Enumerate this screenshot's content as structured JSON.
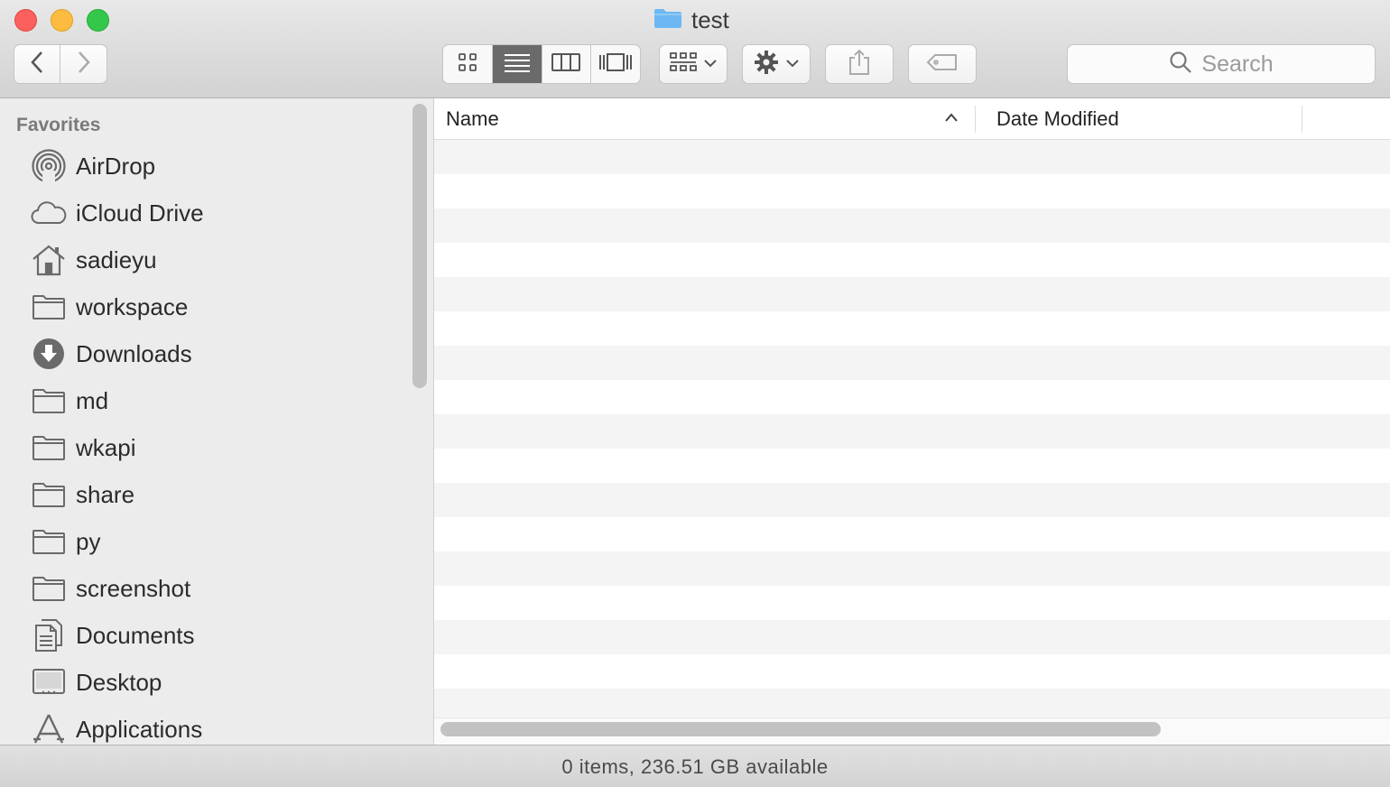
{
  "window": {
    "title": "test"
  },
  "toolbar": {
    "back": "back",
    "forward": "forward",
    "views": [
      "icon-view",
      "list-view",
      "column-view",
      "cover-flow-view"
    ],
    "active_view": "list-view",
    "arrange": "arrange-menu",
    "action": "action-menu",
    "share": "share",
    "tags": "tags",
    "search_placeholder": "Search"
  },
  "sidebar": {
    "heading": "Favorites",
    "items": [
      {
        "label": "AirDrop",
        "icon": "airdrop-icon"
      },
      {
        "label": "iCloud Drive",
        "icon": "cloud-icon"
      },
      {
        "label": "sadieyu",
        "icon": "home-icon"
      },
      {
        "label": "workspace",
        "icon": "folder-icon"
      },
      {
        "label": "Downloads",
        "icon": "download-icon"
      },
      {
        "label": "md",
        "icon": "folder-icon"
      },
      {
        "label": "wkapi",
        "icon": "folder-icon"
      },
      {
        "label": "share",
        "icon": "folder-icon"
      },
      {
        "label": "py",
        "icon": "folder-icon"
      },
      {
        "label": "screenshot",
        "icon": "folder-icon"
      },
      {
        "label": "Documents",
        "icon": "documents-icon"
      },
      {
        "label": "Desktop",
        "icon": "desktop-icon"
      },
      {
        "label": "Applications",
        "icon": "applications-icon"
      }
    ]
  },
  "list": {
    "columns": {
      "name": "Name",
      "date_modified": "Date Modified"
    },
    "sort": "ascending",
    "rows": []
  },
  "status": {
    "text": "0 items, 236.51 GB available"
  },
  "colors": {
    "accent": "#5aaef0",
    "active_segment": "#6a6a6a"
  }
}
